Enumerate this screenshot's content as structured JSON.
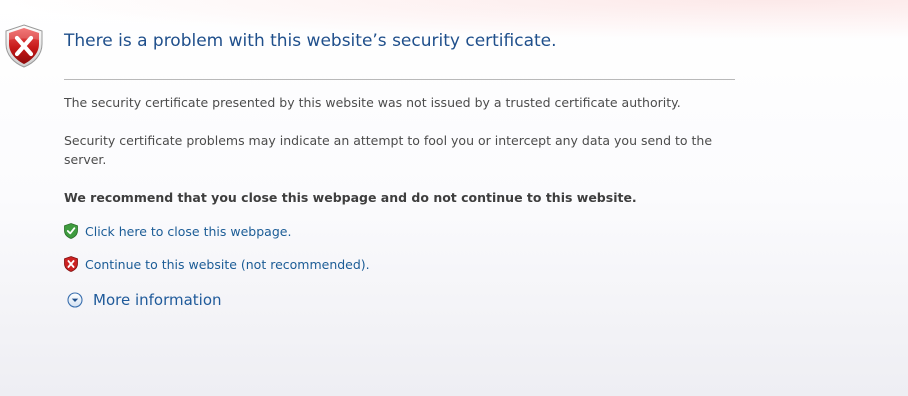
{
  "header": {
    "title": "There is a problem with this website’s security certificate.",
    "icon": "error-shield-icon"
  },
  "body": {
    "paragraph_1": "The security certificate presented by this website was not issued by a trusted certificate authority.",
    "paragraph_2": "Security certificate problems may indicate an attempt to fool you or intercept any data you send to the server.",
    "recommendation": "We recommend that you close this webpage and do not continue to this website."
  },
  "links": {
    "close": {
      "label": "Click here to close this webpage.",
      "icon": "green-check-shield-icon"
    },
    "continue": {
      "label": "Continue to this website (not recommended).",
      "icon": "red-x-shield-icon"
    },
    "more_info": {
      "label": "More information",
      "icon": "expand-chevron-icon"
    }
  },
  "colors": {
    "title": "#1f4f8b",
    "link": "#1b5c96",
    "error_red": "#c8102e",
    "safe_green": "#2e8b2e"
  }
}
